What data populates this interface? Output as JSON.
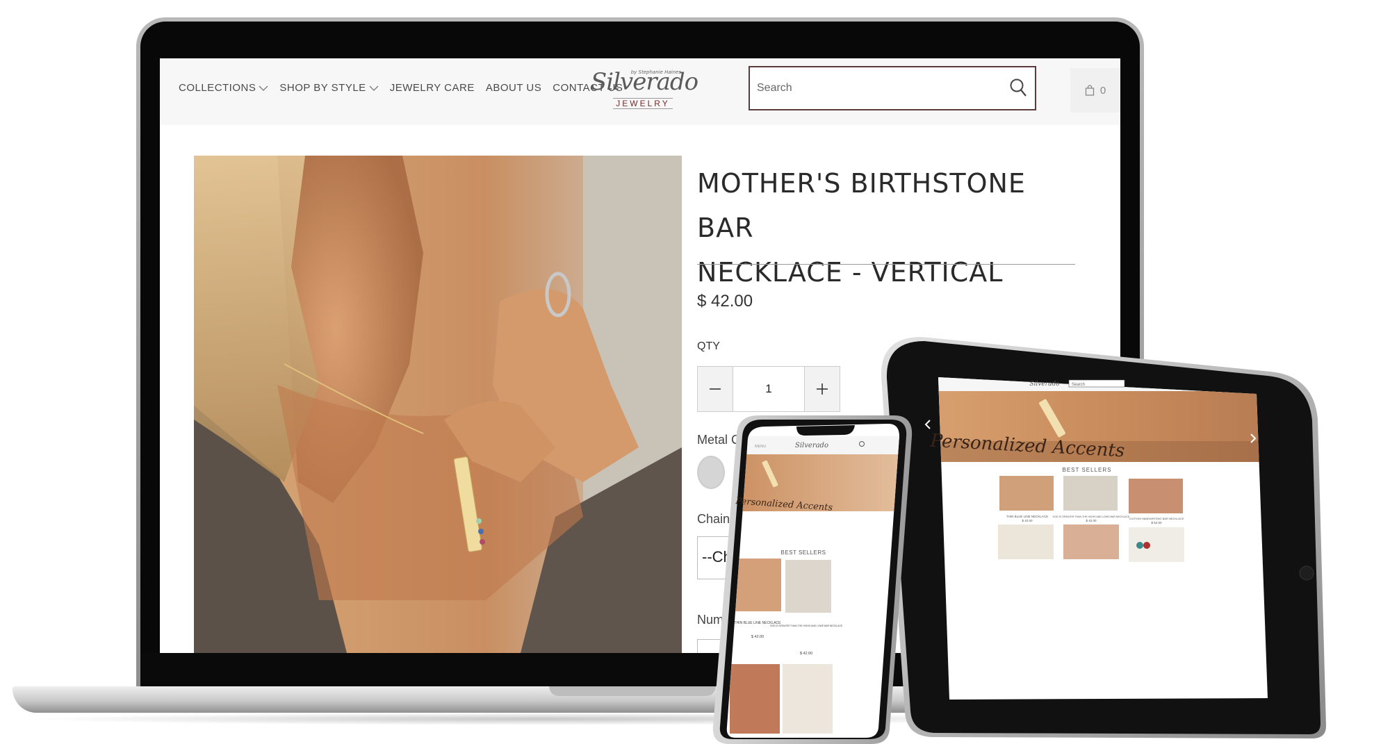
{
  "nav": {
    "items": [
      {
        "label": "COLLECTIONS",
        "dropdown": true
      },
      {
        "label": "SHOP BY STYLE",
        "dropdown": true
      },
      {
        "label": "JEWELRY CARE",
        "dropdown": false
      },
      {
        "label": "ABOUT US",
        "dropdown": false
      },
      {
        "label": "CONTACT US",
        "dropdown": false
      }
    ]
  },
  "logo": {
    "script": "Silverado",
    "sub": "JEWELRY",
    "by": "by Stephanie Haines"
  },
  "search": {
    "placeholder": "Search"
  },
  "cart": {
    "count": "0"
  },
  "product": {
    "title_line1": "MOTHER'S BIRTHSTONE BAR",
    "title_line2": "NECKLACE - VERTICAL",
    "price": "$ 42.00",
    "qty_label": "QTY",
    "qty_value": "1",
    "metal_label": "Metal Color",
    "chain_label": "Chain Le",
    "chain_select": "--Cho",
    "num_label": "Num"
  },
  "phone": {
    "menu_label": "MENU",
    "logo_text": "Silverado",
    "hero_script": "Personalized Accents",
    "section_title": "BEST SELLERS",
    "items": [
      {
        "name": "THIN BLUE LINE NECKLACE",
        "price": "$ 42.00"
      },
      {
        "name": "GOD IS GREATER THAN THE HIGHS AND LOWS BAR NECKLACE",
        "price": "$ 42.00"
      }
    ]
  },
  "tablet": {
    "logo_text": "Silverado",
    "search_placeholder": "Search",
    "hero_script": "Personalized Accents",
    "section_title": "BEST SELLERS",
    "items": [
      {
        "name": "THIN BLUE LINE NECKLACE",
        "price": "$ 42.00"
      },
      {
        "name": "GOD IS GREATER THAN THE HIGHS AND LOWS BAR NECKLACE",
        "price": "$ 42.00"
      },
      {
        "name": "CUSTOM HANDWRITING BAR NECKLACE",
        "price": "$ 52.00"
      }
    ]
  },
  "colors": {
    "accent": "#5a3a3a",
    "logo_red": "#7a2a2a",
    "swatch_silver": "#d5d5d5",
    "swatch_gold": "#e9d8a6"
  }
}
